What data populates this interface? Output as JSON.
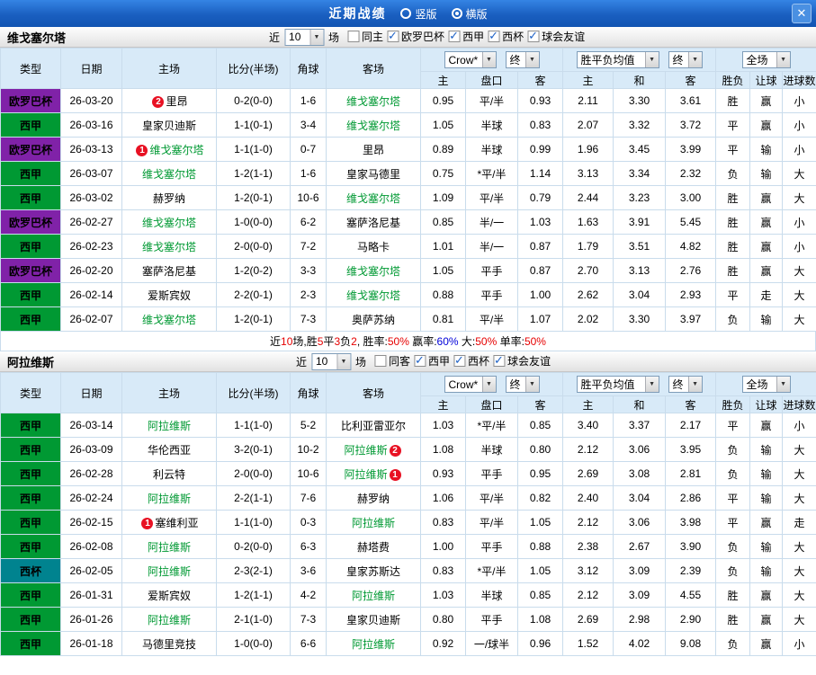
{
  "titlebar": {
    "title": "近期战绩",
    "options": [
      {
        "label": "竖版",
        "selected": false
      },
      {
        "label": "横版",
        "selected": true
      }
    ],
    "close_label": "✕"
  },
  "columns": [
    "类型",
    "日期",
    "主场",
    "比分(半场)",
    "角球",
    "客场",
    "主",
    "盘口",
    "客",
    "主",
    "和",
    "客",
    "胜负",
    "让球",
    "进球数"
  ],
  "type_colors": {
    "欧罗巴杯": "#8022a8",
    "西甲": "#009933",
    "西杯": "#00838f"
  },
  "colors": {
    "red": "#e60000",
    "green": "#009933",
    "blue": "#0000d8",
    "header_bg": "#d8eaf8",
    "titlebar_blue": "#1a5fc0"
  },
  "sections": [
    {
      "team": "维戈塞尔塔",
      "filters": {
        "recent_label": "近",
        "count": "10",
        "games_label": "场",
        "checkboxes": [
          {
            "label": "同主",
            "checked": false
          },
          {
            "label": "欧罗巴杯",
            "checked": true
          },
          {
            "label": "西甲",
            "checked": true
          },
          {
            "label": "西杯",
            "checked": true
          },
          {
            "label": "球会友谊",
            "checked": true
          }
        ]
      },
      "dropdowns": {
        "source": "Crow*",
        "final1": "终",
        "avg": "胜平负均值",
        "final2": "终",
        "scope": "全场"
      },
      "rows": [
        {
          "type": "欧罗巴杯",
          "date": "26-03-20",
          "home": "里昂",
          "home_badge": "2",
          "score": "0-2(0-0)",
          "corner": "1-6",
          "away": "维戈塞尔塔",
          "away_focus": true,
          "odds": [
            "0.95",
            "平/半",
            "0.93"
          ],
          "avg": [
            "2.11",
            "3.30",
            "3.61"
          ],
          "results": [
            [
              "胜",
              "red"
            ],
            [
              "赢",
              "red"
            ],
            [
              "小",
              "green"
            ]
          ]
        },
        {
          "type": "西甲",
          "date": "26-03-16",
          "home": "皇家贝迪斯",
          "score": "1-1(0-1)",
          "corner": "3-4",
          "away": "维戈塞尔塔",
          "away_focus": true,
          "odds": [
            "1.05",
            "半球",
            "0.83"
          ],
          "avg": [
            "2.07",
            "3.32",
            "3.72"
          ],
          "results": [
            [
              "平",
              "blue"
            ],
            [
              "赢",
              "red"
            ],
            [
              "小",
              "green"
            ]
          ]
        },
        {
          "type": "欧罗巴杯",
          "date": "26-03-13",
          "home": "维戈塞尔塔",
          "home_focus": true,
          "home_badge": "1",
          "score": "1-1(1-0)",
          "corner": "0-7",
          "away": "里昂",
          "odds": [
            "0.89",
            "半球",
            "0.99"
          ],
          "avg": [
            "1.96",
            "3.45",
            "3.99"
          ],
          "results": [
            [
              "平",
              "blue"
            ],
            [
              "输",
              "green"
            ],
            [
              "小",
              "green"
            ]
          ]
        },
        {
          "type": "西甲",
          "date": "26-03-07",
          "home": "维戈塞尔塔",
          "home_focus": true,
          "score": "1-2(1-1)",
          "corner": "1-6",
          "away": "皇家马德里",
          "odds": [
            "0.75",
            "*平/半",
            "1.14"
          ],
          "hcap_red": true,
          "avg": [
            "3.13",
            "3.34",
            "2.32"
          ],
          "results": [
            [
              "负",
              "red"
            ],
            [
              "输",
              "green"
            ],
            [
              "大",
              "red"
            ]
          ]
        },
        {
          "type": "西甲",
          "date": "26-03-02",
          "home": "赫罗纳",
          "score": "1-2(0-1)",
          "corner": "10-6",
          "away": "维戈塞尔塔",
          "away_focus": true,
          "odds": [
            "1.09",
            "平/半",
            "0.79"
          ],
          "avg": [
            "2.44",
            "3.23",
            "3.00"
          ],
          "results": [
            [
              "胜",
              "red"
            ],
            [
              "赢",
              "red"
            ],
            [
              "大",
              "red"
            ]
          ]
        },
        {
          "type": "欧罗巴杯",
          "date": "26-02-27",
          "home": "维戈塞尔塔",
          "home_focus": true,
          "score": "1-0(0-0)",
          "corner": "6-2",
          "away": "塞萨洛尼基",
          "odds": [
            "0.85",
            "半/一",
            "1.03"
          ],
          "avg": [
            "1.63",
            "3.91",
            "5.45"
          ],
          "results": [
            [
              "胜",
              "red"
            ],
            [
              "赢",
              "red"
            ],
            [
              "小",
              "green"
            ]
          ]
        },
        {
          "type": "西甲",
          "date": "26-02-23",
          "home": "维戈塞尔塔",
          "home_focus": true,
          "score": "2-0(0-0)",
          "corner": "7-2",
          "away": "马略卡",
          "odds": [
            "1.01",
            "半/一",
            "0.87"
          ],
          "avg": [
            "1.79",
            "3.51",
            "4.82"
          ],
          "results": [
            [
              "胜",
              "red"
            ],
            [
              "赢",
              "red"
            ],
            [
              "小",
              "green"
            ]
          ]
        },
        {
          "type": "欧罗巴杯",
          "date": "26-02-20",
          "home": "塞萨洛尼基",
          "score": "1-2(0-2)",
          "corner": "3-3",
          "away": "维戈塞尔塔",
          "away_focus": true,
          "odds": [
            "1.05",
            "平手",
            "0.87"
          ],
          "avg": [
            "2.70",
            "3.13",
            "2.76"
          ],
          "results": [
            [
              "胜",
              "red"
            ],
            [
              "赢",
              "red"
            ],
            [
              "大",
              "red"
            ]
          ]
        },
        {
          "type": "西甲",
          "date": "26-02-14",
          "home": "爱斯宾奴",
          "score": "2-2(0-1)",
          "corner": "2-3",
          "away": "维戈塞尔塔",
          "away_focus": true,
          "odds": [
            "0.88",
            "平手",
            "1.00"
          ],
          "avg": [
            "2.62",
            "3.04",
            "2.93"
          ],
          "results": [
            [
              "平",
              "blue"
            ],
            [
              "走",
              "blue"
            ],
            [
              "大",
              "red"
            ]
          ]
        },
        {
          "type": "西甲",
          "date": "26-02-07",
          "home": "维戈塞尔塔",
          "home_focus": true,
          "score": "1-2(0-1)",
          "corner": "7-3",
          "away": "奥萨苏纳",
          "odds": [
            "0.81",
            "平/半",
            "1.07"
          ],
          "avg": [
            "2.02",
            "3.30",
            "3.97"
          ],
          "results": [
            [
              "负",
              "red"
            ],
            [
              "输",
              "green"
            ],
            [
              "大",
              "red"
            ]
          ]
        }
      ],
      "summary": [
        [
          "近",
          "black"
        ],
        [
          "10",
          "red"
        ],
        [
          "场,胜",
          "black"
        ],
        [
          "5",
          "red"
        ],
        [
          "平",
          "black"
        ],
        [
          "3",
          "red"
        ],
        [
          "负",
          "black"
        ],
        [
          "2",
          "red"
        ],
        [
          ", 胜率:",
          "black"
        ],
        [
          "50%",
          "red"
        ],
        [
          " 赢率:",
          "black"
        ],
        [
          "60%",
          "blue"
        ],
        [
          " 大:",
          "black"
        ],
        [
          "50%",
          "red"
        ],
        [
          " 单率:",
          "black"
        ],
        [
          "50%",
          "red"
        ]
      ]
    },
    {
      "team": "阿拉维斯",
      "filters": {
        "recent_label": "近",
        "count": "10",
        "games_label": "场",
        "checkboxes": [
          {
            "label": "同客",
            "checked": false
          },
          {
            "label": "西甲",
            "checked": true
          },
          {
            "label": "西杯",
            "checked": true
          },
          {
            "label": "球会友谊",
            "checked": true
          }
        ]
      },
      "dropdowns": {
        "source": "Crow*",
        "final1": "终",
        "avg": "胜平负均值",
        "final2": "终",
        "scope": "全场"
      },
      "rows": [
        {
          "type": "西甲",
          "date": "26-03-14",
          "home": "阿拉维斯",
          "home_focus": true,
          "score": "1-1(1-0)",
          "corner": "5-2",
          "away": "比利亚雷亚尔",
          "odds": [
            "1.03",
            "*平/半",
            "0.85"
          ],
          "hcap_red": true,
          "avg": [
            "3.40",
            "3.37",
            "2.17"
          ],
          "results": [
            [
              "平",
              "blue"
            ],
            [
              "赢",
              "red"
            ],
            [
              "小",
              "green"
            ]
          ]
        },
        {
          "type": "西甲",
          "date": "26-03-09",
          "home": "华伦西亚",
          "score": "3-2(0-1)",
          "corner": "10-2",
          "away": "阿拉维斯",
          "away_focus": true,
          "away_badge": "2",
          "odds": [
            "1.08",
            "半球",
            "0.80"
          ],
          "avg": [
            "2.12",
            "3.06",
            "3.95"
          ],
          "results": [
            [
              "负",
              "red"
            ],
            [
              "输",
              "green"
            ],
            [
              "大",
              "red"
            ]
          ]
        },
        {
          "type": "西甲",
          "date": "26-02-28",
          "home": "利云特",
          "score": "2-0(0-0)",
          "corner": "10-6",
          "away": "阿拉维斯",
          "away_focus": true,
          "away_badge": "1",
          "odds": [
            "0.93",
            "平手",
            "0.95"
          ],
          "avg": [
            "2.69",
            "3.08",
            "2.81"
          ],
          "results": [
            [
              "负",
              "red"
            ],
            [
              "输",
              "green"
            ],
            [
              "大",
              "red"
            ]
          ]
        },
        {
          "type": "西甲",
          "date": "26-02-24",
          "home": "阿拉维斯",
          "home_focus": true,
          "score": "2-2(1-1)",
          "corner": "7-6",
          "away": "赫罗纳",
          "odds": [
            "1.06",
            "平/半",
            "0.82"
          ],
          "avg": [
            "2.40",
            "3.04",
            "2.86"
          ],
          "results": [
            [
              "平",
              "blue"
            ],
            [
              "输",
              "green"
            ],
            [
              "大",
              "red"
            ]
          ]
        },
        {
          "type": "西甲",
          "date": "26-02-15",
          "home": "塞维利亚",
          "home_badge": "1",
          "score": "1-1(1-0)",
          "corner": "0-3",
          "away": "阿拉维斯",
          "away_focus": true,
          "odds": [
            "0.83",
            "平/半",
            "1.05"
          ],
          "avg": [
            "2.12",
            "3.06",
            "3.98"
          ],
          "results": [
            [
              "平",
              "blue"
            ],
            [
              "赢",
              "red"
            ],
            [
              "走",
              "blue"
            ]
          ]
        },
        {
          "type": "西甲",
          "date": "26-02-08",
          "home": "阿拉维斯",
          "home_focus": true,
          "score": "0-2(0-0)",
          "corner": "6-3",
          "away": "赫塔费",
          "odds": [
            "1.00",
            "平手",
            "0.88"
          ],
          "avg": [
            "2.38",
            "2.67",
            "3.90"
          ],
          "results": [
            [
              "负",
              "red"
            ],
            [
              "输",
              "green"
            ],
            [
              "大",
              "red"
            ]
          ]
        },
        {
          "type": "西杯",
          "date": "26-02-05",
          "home": "阿拉维斯",
          "home_focus": true,
          "score": "2-3(2-1)",
          "corner": "3-6",
          "away": "皇家苏斯达",
          "odds": [
            "0.83",
            "*平/半",
            "1.05"
          ],
          "hcap_red": true,
          "avg": [
            "3.12",
            "3.09",
            "2.39"
          ],
          "results": [
            [
              "负",
              "red"
            ],
            [
              "输",
              "green"
            ],
            [
              "大",
              "red"
            ]
          ]
        },
        {
          "type": "西甲",
          "date": "26-01-31",
          "home": "爱斯宾奴",
          "score": "1-2(1-1)",
          "corner": "4-2",
          "away": "阿拉维斯",
          "away_focus": true,
          "odds": [
            "1.03",
            "半球",
            "0.85"
          ],
          "avg": [
            "2.12",
            "3.09",
            "4.55"
          ],
          "results": [
            [
              "胜",
              "red"
            ],
            [
              "赢",
              "red"
            ],
            [
              "大",
              "red"
            ]
          ]
        },
        {
          "type": "西甲",
          "date": "26-01-26",
          "home": "阿拉维斯",
          "home_focus": true,
          "score": "2-1(1-0)",
          "corner": "7-3",
          "away": "皇家贝迪斯",
          "odds": [
            "0.80",
            "平手",
            "1.08"
          ],
          "avg": [
            "2.69",
            "2.98",
            "2.90"
          ],
          "results": [
            [
              "胜",
              "red"
            ],
            [
              "赢",
              "red"
            ],
            [
              "大",
              "red"
            ]
          ]
        },
        {
          "type": "西甲",
          "date": "26-01-18",
          "home": "马德里竞技",
          "score": "1-0(0-0)",
          "corner": "6-6",
          "away": "阿拉维斯",
          "away_focus": true,
          "odds": [
            "0.92",
            "一/球半",
            "0.96"
          ],
          "avg": [
            "1.52",
            "4.02",
            "9.08"
          ],
          "results": [
            [
              "负",
              "red"
            ],
            [
              "赢",
              "red"
            ],
            [
              "小",
              "green"
            ]
          ]
        }
      ]
    }
  ]
}
